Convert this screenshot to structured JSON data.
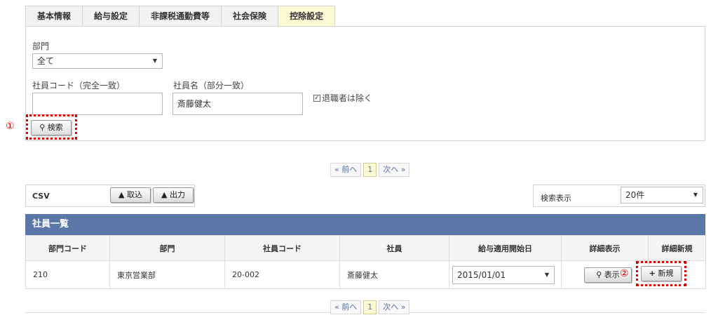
{
  "tabs": [
    "基本情報",
    "給与設定",
    "非課税通勤費等",
    "社会保険",
    "控除設定"
  ],
  "search": {
    "dept_label": "部門",
    "dept_value": "全て",
    "code_label": "社員コード（完全一致）",
    "code_value": "",
    "name_label": "社員名（部分一致）",
    "name_value": "斎藤健太",
    "exclude_label": "退職者は除く",
    "exclude_checked": true,
    "search_button": "検索",
    "marker": "①"
  },
  "pager": {
    "prev": "« 前へ",
    "page": "1",
    "next": "次へ »"
  },
  "csv": {
    "label": "CSV",
    "import_button": "取込",
    "export_button": "出力"
  },
  "display": {
    "label": "検索表示",
    "value": "20件"
  },
  "list": {
    "title": "社員一覧",
    "columns": [
      "部門コード",
      "部門",
      "社員コード",
      "社員",
      "給与適用開始日",
      "詳細表示",
      "詳細新規"
    ],
    "rows": [
      {
        "dept_code": "210",
        "dept": "東京営業部",
        "emp_code": "20-002",
        "emp": "斎藤健太",
        "start_date": "2015/01/01",
        "view_button": "表示",
        "new_button": "新規",
        "marker": "②"
      }
    ]
  },
  "colors": {
    "header_blue": "#5b77a8",
    "active_tab": "#fbfbd3",
    "marker_red": "#e00000"
  }
}
